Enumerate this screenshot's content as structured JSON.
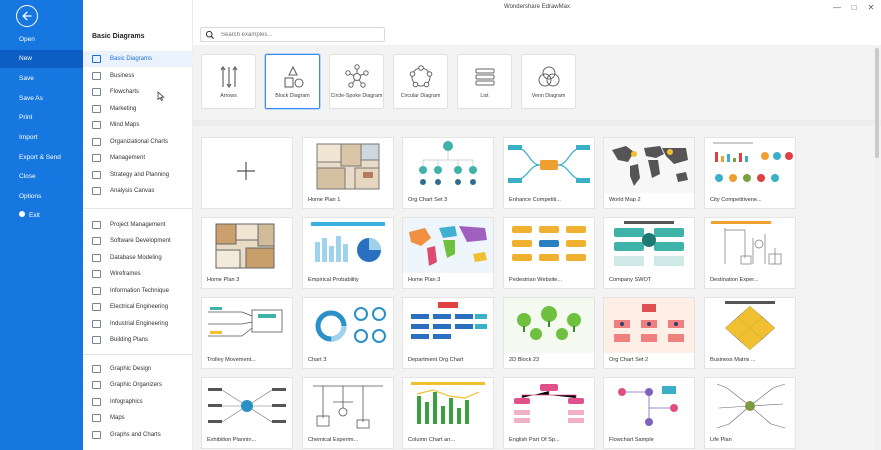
{
  "app": {
    "title": "Wondershare EdrawMax"
  },
  "window_buttons": [
    "—",
    "□",
    "✕"
  ],
  "backstage": {
    "items": [
      {
        "label": "Open"
      },
      {
        "label": "New"
      },
      {
        "label": "Save"
      },
      {
        "label": "Save As"
      },
      {
        "label": "Print"
      },
      {
        "label": "Import"
      },
      {
        "label": "Export & Send"
      },
      {
        "label": "Close"
      },
      {
        "label": "Options"
      },
      {
        "label": "Exit"
      }
    ],
    "active": "New"
  },
  "categories": {
    "title": "Basic Diagrams",
    "group1": [
      "Basic Diagrams",
      "Business",
      "Flowcharts",
      "Marketing",
      "Mind Maps",
      "Organizational Charts",
      "Management",
      "Strategy and Planning",
      "Analysis Canvas"
    ],
    "group2": [
      "Project Management",
      "Software Development",
      "Database Modeling",
      "Wireframes",
      "Information Technique",
      "Electrical Engineering",
      "Industrial Engineering",
      "Building Plans"
    ],
    "group3": [
      "Graphic Design",
      "Graphic Organizers",
      "Infographics",
      "Maps",
      "Graphs and Charts"
    ],
    "active": "Basic Diagrams"
  },
  "search": {
    "placeholder": "Search examples..."
  },
  "diagram_types": [
    {
      "label": "Arrows",
      "icon": "arrows-icon"
    },
    {
      "label": "Block Diagram",
      "icon": "block-diagram-icon"
    },
    {
      "label": "Circle-Spoke Diagram",
      "icon": "circle-spoke-icon"
    },
    {
      "label": "Circular Diagram",
      "icon": "circular-diagram-icon"
    },
    {
      "label": "List",
      "icon": "list-icon"
    },
    {
      "label": "Venn Diagram",
      "icon": "venn-diagram-icon"
    }
  ],
  "selected_type": "Block Diagram",
  "templates": [
    {
      "name": "",
      "blank": true
    },
    {
      "name": "Home Plan 1"
    },
    {
      "name": "Org Chart Set 3"
    },
    {
      "name": "Enhance Competiti..."
    },
    {
      "name": "World Map 2"
    },
    {
      "name": "City Competitivene..."
    },
    {
      "name": "Home Plan 3"
    },
    {
      "name": "Empirical Probability"
    },
    {
      "name": "Home Plan 3"
    },
    {
      "name": "Pedestrian Website..."
    },
    {
      "name": "Company SWOT"
    },
    {
      "name": "Destination Exper..."
    },
    {
      "name": "Trolley Movement..."
    },
    {
      "name": "Chart 3"
    },
    {
      "name": "Department Org Chart"
    },
    {
      "name": "2D Block 23"
    },
    {
      "name": "Org Chart Set 2"
    },
    {
      "name": "Business Matrix ..."
    },
    {
      "name": "Exhibition Plannin..."
    },
    {
      "name": "Chemical Experim..."
    },
    {
      "name": "Column Chart an..."
    },
    {
      "name": "English Part Of Sp..."
    },
    {
      "name": "Flowchart Sample"
    },
    {
      "name": "Life Plan"
    }
  ],
  "colors": {
    "brand_blue": "#1677e0",
    "selected_border": "#3d8bf0"
  }
}
